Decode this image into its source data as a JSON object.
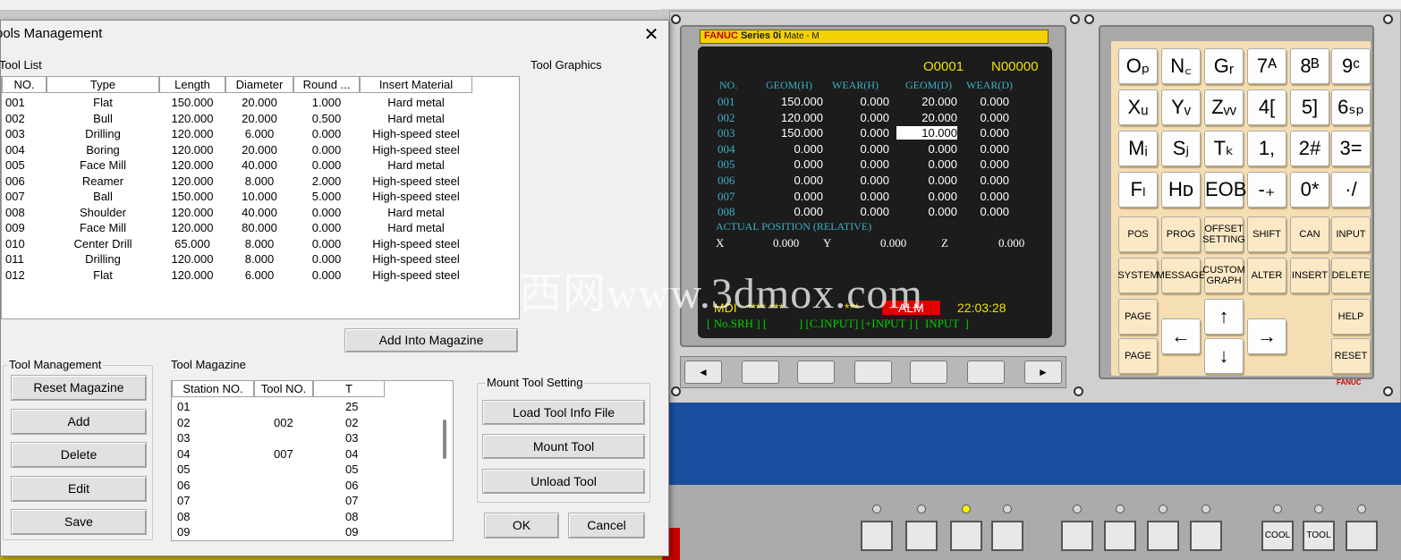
{
  "dialog": {
    "title": "ools Management",
    "close_glyph": "✕",
    "tool_list_label": "Tool List",
    "tool_graphics_label": "Tool Graphics",
    "columns": [
      "NO.",
      "Type",
      "Length",
      "Diameter",
      "Round ...",
      "Insert Material"
    ],
    "tools": [
      {
        "no": "001",
        "type": "Flat",
        "length": "150.000",
        "diameter": "20.000",
        "round": "1.000",
        "material": "Hard metal"
      },
      {
        "no": "002",
        "type": "Bull",
        "length": "120.000",
        "diameter": "20.000",
        "round": "0.500",
        "material": "Hard metal"
      },
      {
        "no": "003",
        "type": "Drilling",
        "length": "120.000",
        "diameter": "6.000",
        "round": "0.000",
        "material": "High-speed steel"
      },
      {
        "no": "004",
        "type": "Boring",
        "length": "120.000",
        "diameter": "20.000",
        "round": "0.000",
        "material": "High-speed steel"
      },
      {
        "no": "005",
        "type": "Face Mill",
        "length": "120.000",
        "diameter": "40.000",
        "round": "0.000",
        "material": "Hard metal"
      },
      {
        "no": "006",
        "type": "Reamer",
        "length": "120.000",
        "diameter": "8.000",
        "round": "2.000",
        "material": "High-speed steel"
      },
      {
        "no": "007",
        "type": "Ball",
        "length": "150.000",
        "diameter": "10.000",
        "round": "5.000",
        "material": "High-speed steel"
      },
      {
        "no": "008",
        "type": "Shoulder",
        "length": "120.000",
        "diameter": "40.000",
        "round": "0.000",
        "material": "Hard metal"
      },
      {
        "no": "009",
        "type": "Face Mill",
        "length": "120.000",
        "diameter": "80.000",
        "round": "0.000",
        "material": "Hard metal"
      },
      {
        "no": "010",
        "type": "Center Drill",
        "length": "65.000",
        "diameter": "8.000",
        "round": "0.000",
        "material": "High-speed steel"
      },
      {
        "no": "011",
        "type": "Drilling",
        "length": "120.000",
        "diameter": "8.000",
        "round": "0.000",
        "material": "High-speed steel"
      },
      {
        "no": "012",
        "type": "Flat",
        "length": "120.000",
        "diameter": "6.000",
        "round": "0.000",
        "material": "High-speed steel"
      }
    ],
    "add_into_magazine": "Add Into Magazine",
    "tool_management_label": "Tool Management",
    "mgmt_buttons": [
      "Reset Magazine",
      "Add",
      "Delete",
      "Edit",
      "Save"
    ],
    "tool_magazine_label": "Tool Magazine",
    "magazine_columns": [
      "Station NO.",
      "Tool NO.",
      "T"
    ],
    "magazine": [
      {
        "station": "01",
        "tool": "",
        "t": "25"
      },
      {
        "station": "02",
        "tool": "002",
        "t": "02"
      },
      {
        "station": "03",
        "tool": "",
        "t": "03"
      },
      {
        "station": "04",
        "tool": "007",
        "t": "04"
      },
      {
        "station": "05",
        "tool": "",
        "t": "05"
      },
      {
        "station": "06",
        "tool": "",
        "t": "06"
      },
      {
        "station": "07",
        "tool": "",
        "t": "07"
      },
      {
        "station": "08",
        "tool": "",
        "t": "08"
      },
      {
        "station": "09",
        "tool": "",
        "t": "09"
      }
    ],
    "mount_setting_label": "Mount Tool Setting",
    "mount_buttons": [
      "Load Tool Info File",
      "Mount Tool",
      "Unload Tool"
    ],
    "ok": "OK",
    "cancel": "Cancel"
  },
  "cnc": {
    "brand": "FANUC",
    "series": "Series 0i",
    "mode_tag": "Mate - M",
    "program": "O0001",
    "sequence": "N00000",
    "headers": [
      "NO.",
      "GEOM(H)",
      "WEAR(H)",
      "GEOM(D)",
      "WEAR(D)"
    ],
    "offsets": [
      {
        "no": "001",
        "gh": "150.000",
        "wh": "0.000",
        "gd": "20.000",
        "wd": "0.000"
      },
      {
        "no": "002",
        "gh": "120.000",
        "wh": "0.000",
        "gd": "20.000",
        "wd": "0.000"
      },
      {
        "no": "003",
        "gh": "150.000",
        "wh": "0.000",
        "gd": "10.000",
        "wd": "0.000"
      },
      {
        "no": "004",
        "gh": "0.000",
        "wh": "0.000",
        "gd": "0.000",
        "wd": "0.000"
      },
      {
        "no": "005",
        "gh": "0.000",
        "wh": "0.000",
        "gd": "0.000",
        "wd": "0.000"
      },
      {
        "no": "006",
        "gh": "0.000",
        "wh": "0.000",
        "gd": "0.000",
        "wd": "0.000"
      },
      {
        "no": "007",
        "gh": "0.000",
        "wh": "0.000",
        "gd": "0.000",
        "wd": "0.000"
      },
      {
        "no": "008",
        "gh": "0.000",
        "wh": "0.000",
        "gd": "0.000",
        "wd": "0.000"
      }
    ],
    "actual_label": "ACTUAL POSITION (RELATIVE)",
    "axes": {
      "x_label": "X",
      "x": "0.000",
      "y_label": "Y",
      "y": "0.000",
      "z_label": "Z",
      "z": "0.000"
    },
    "mode": "MDI",
    "stars1": "**** ***",
    "stars2": "***",
    "alarm": "ALM",
    "clock": "22:03:28",
    "softkeys_text": "[ No.SRH ] [           ] [C.INPUT] [+INPUT ] [  INPUT  ]",
    "nav_left": "◄",
    "nav_right": "►"
  },
  "keypad": {
    "keys": [
      [
        "Oₚ",
        "N_Q",
        "G_R",
        "7 A",
        "8 B",
        "9 C"
      ],
      [
        "X_U",
        "Y_V",
        "Z_W",
        "4 [",
        "5 ]",
        "6 SP"
      ],
      [
        "M_I",
        "S_J",
        "T_K",
        "1 ,",
        "2 #",
        "3 ="
      ],
      [
        "F_L",
        "H_D",
        "EOB_E",
        "- +",
        "0 *",
        ". /"
      ]
    ],
    "row1": [
      "Oₚ",
      "N꜀",
      "Gᵣ",
      "7ᴬ",
      "8ᴮ",
      "9ᶜ"
    ],
    "row2": [
      "Xᵤ",
      "Yᵥ",
      "Zᵥᵥ",
      "4[",
      "5]",
      "6ₛₚ"
    ],
    "row3": [
      "Mᵢ",
      "Sⱼ",
      "Tₖ",
      "1,",
      "2#",
      "3="
    ],
    "row4": [
      "Fₗ",
      "Hᴅ",
      "EOBₑ",
      "-₊",
      "0*",
      "·/"
    ],
    "fn_row1": [
      "POS",
      "PROG",
      "OFFSET SETTING",
      "SHIFT",
      "CAN",
      "INPUT"
    ],
    "fn_row2": [
      "SYSTEM",
      "MESSAGE",
      "CUSTOM GRAPH",
      "ALTER",
      "INSERT",
      "DELETE"
    ],
    "page_up": "PAGE",
    "page_down": "PAGE",
    "help": "HELP",
    "reset": "RESET",
    "up": "↑",
    "down": "↓",
    "left": "←",
    "right": "→",
    "logo": "FANUC"
  },
  "operator_panel": {
    "buttons": [
      "COOL",
      "TOOL"
    ]
  },
  "watermark": "西网www.3dmox.com"
}
